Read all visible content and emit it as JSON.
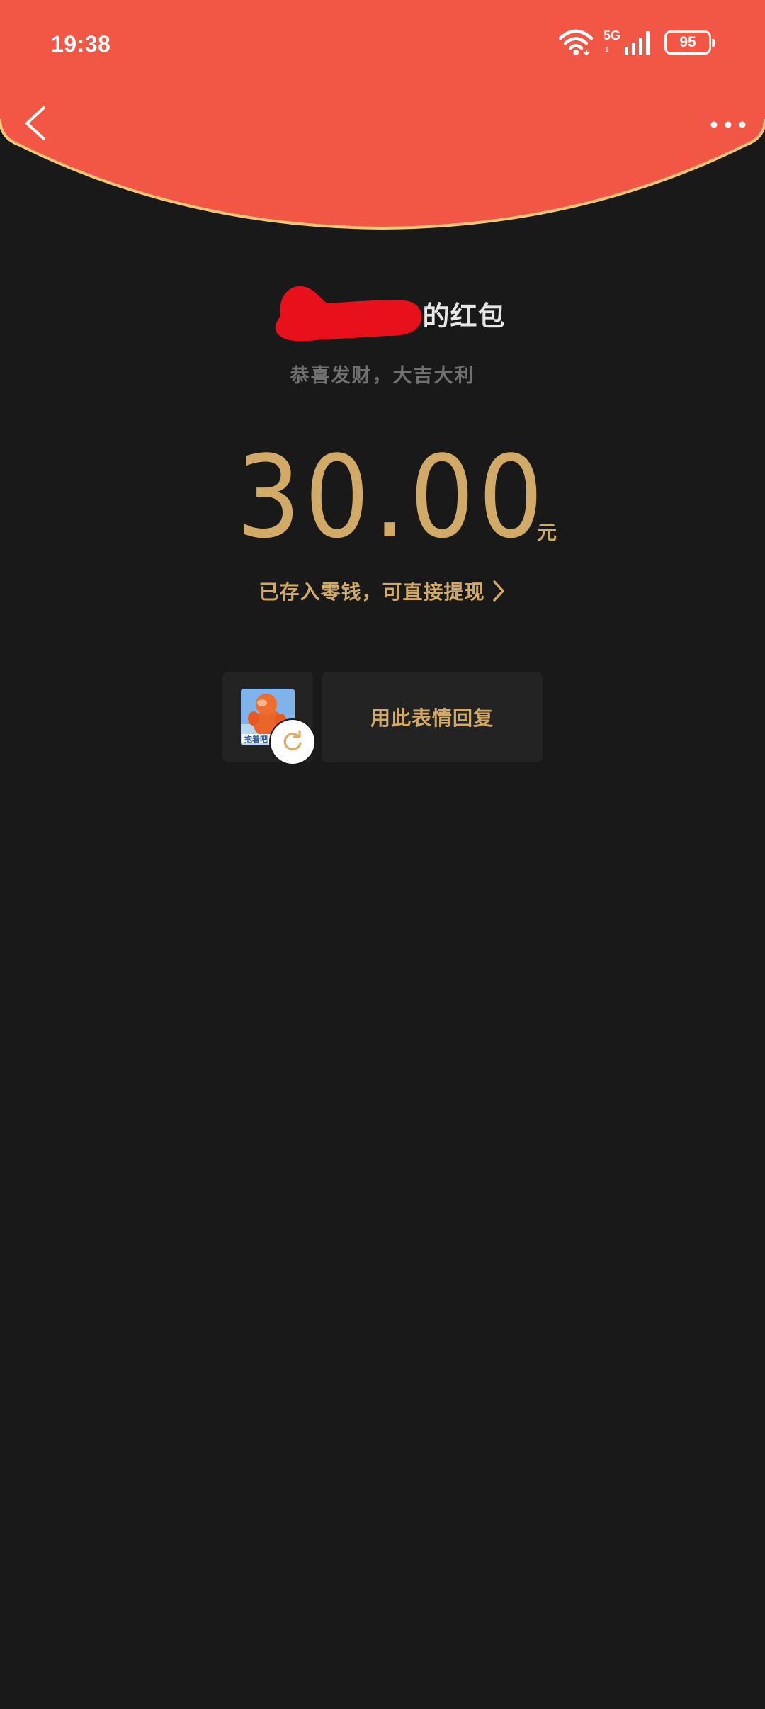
{
  "status_bar": {
    "time": "19:38",
    "network": "5G",
    "network_sub": "1",
    "battery": "95"
  },
  "envelope": {
    "sender_suffix": "的红包",
    "greeting": "恭喜发财，大吉大利",
    "amount": "30.00",
    "unit": "元",
    "stored_text": "已存入零钱，可直接提现"
  },
  "reply": {
    "sticker_label": "抱着吧",
    "reply_label": "用此表情回复"
  },
  "colors": {
    "header_red": "#f25746",
    "header_edge": "#f6c777",
    "gold": "#d2aa67",
    "background": "#191919",
    "card": "#232323",
    "redaction": "#e8101a"
  },
  "icons": {
    "back": "back-arrow-icon",
    "more": "more-dots-icon",
    "chevron": "chevron-right-icon",
    "refresh": "refresh-icon",
    "wifi": "wifi-icon",
    "signal": "signal-icon",
    "battery": "battery-icon"
  }
}
